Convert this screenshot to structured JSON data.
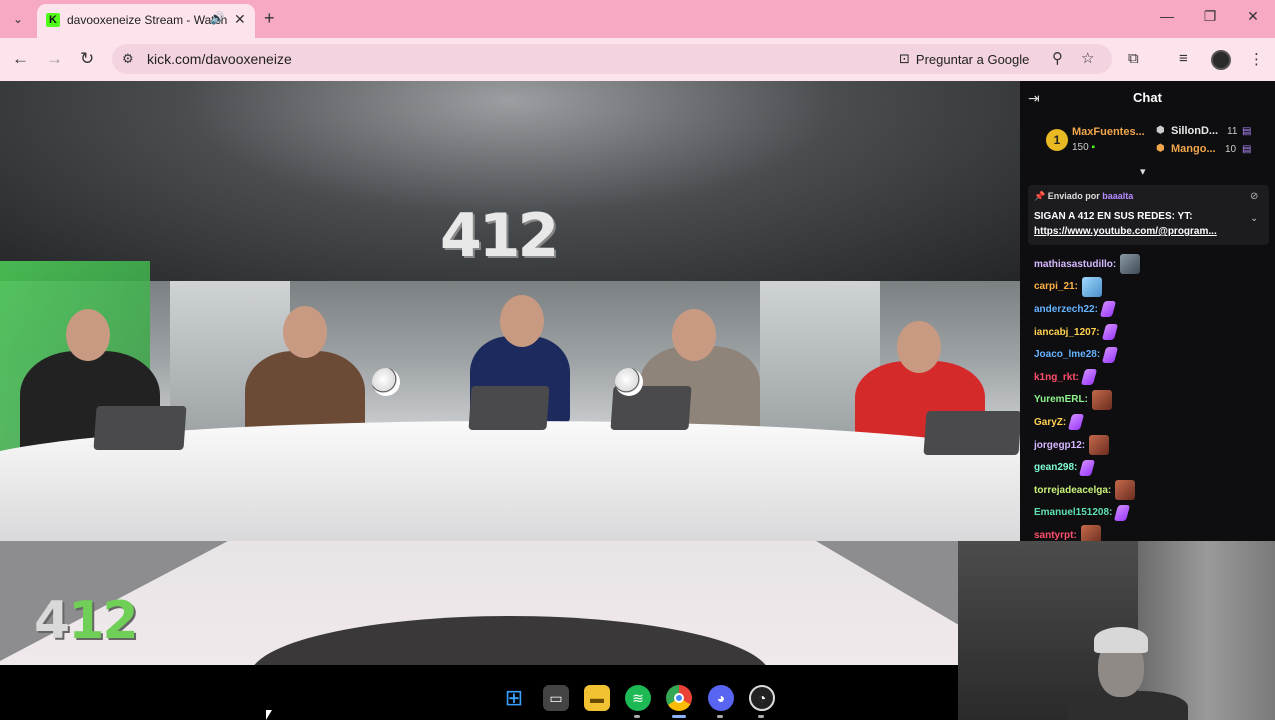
{
  "browser": {
    "tab": {
      "title": "davooxeneize Stream - Watch",
      "favicon": "kick-logo-icon"
    },
    "url": "kick.com/davooxeneize",
    "ask_google": "Preguntar a Google"
  },
  "video": {
    "logo_text": "412",
    "corner_logo_left": "4",
    "corner_logo_right": "12"
  },
  "chat": {
    "title": "Chat",
    "leaderboard": [
      {
        "rank": "1",
        "name": "MaxFuentes...",
        "value": "150",
        "color": "#f0a64b"
      },
      {
        "name": "SillonD...",
        "value": "11",
        "color": "#e8e8e8"
      },
      {
        "name": "Mango...",
        "value": "10",
        "color": "#f0a64b"
      }
    ],
    "pinned": {
      "sent_by_label": "Enviado por",
      "sent_by": "baaalta",
      "line1": "SIGAN A 412 EN SUS REDES: YT:",
      "link": "https://www.youtube.com/@program..."
    },
    "messages": [
      {
        "user": "mathiasastudillo:",
        "color": "#d7b8ff",
        "emote": "grey"
      },
      {
        "user": "carpi_21:",
        "color": "#ffb347",
        "emote": "blue"
      },
      {
        "user": "anderzech22:",
        "color": "#66b3ff",
        "emote": "purple"
      },
      {
        "user": "iancabj_1207:",
        "color": "#ffd24d",
        "emote": "purple"
      },
      {
        "user": "Joaco_lme28:",
        "color": "#66b3ff",
        "emote": "purple"
      },
      {
        "user": "k1ng_rkt:",
        "color": "#ff4f6d",
        "emote": "purple"
      },
      {
        "user": "YuremERL:",
        "color": "#8ef58e",
        "emote": "face"
      },
      {
        "user": "GaryZ:",
        "color": "#ffd24d",
        "emote": "purple"
      },
      {
        "user": "jorgegp12:",
        "color": "#d7b8ff",
        "emote": "face"
      },
      {
        "user": "gean298:",
        "color": "#7fffd4",
        "emote": "purple"
      },
      {
        "user": "torrejadeacelga:",
        "color": "#c9f27a",
        "emote": "face"
      },
      {
        "user": "Emanuel151208:",
        "color": "#5fe0b0",
        "emote": "purple"
      },
      {
        "user": "santyrpt:",
        "color": "#ff4f6d",
        "emote": "face"
      }
    ]
  },
  "taskbar": {
    "apps": [
      "windows-start-icon",
      "task-view-icon",
      "file-explorer-icon",
      "spotify-icon",
      "chrome-icon",
      "discord-icon",
      "obs-icon"
    ]
  }
}
